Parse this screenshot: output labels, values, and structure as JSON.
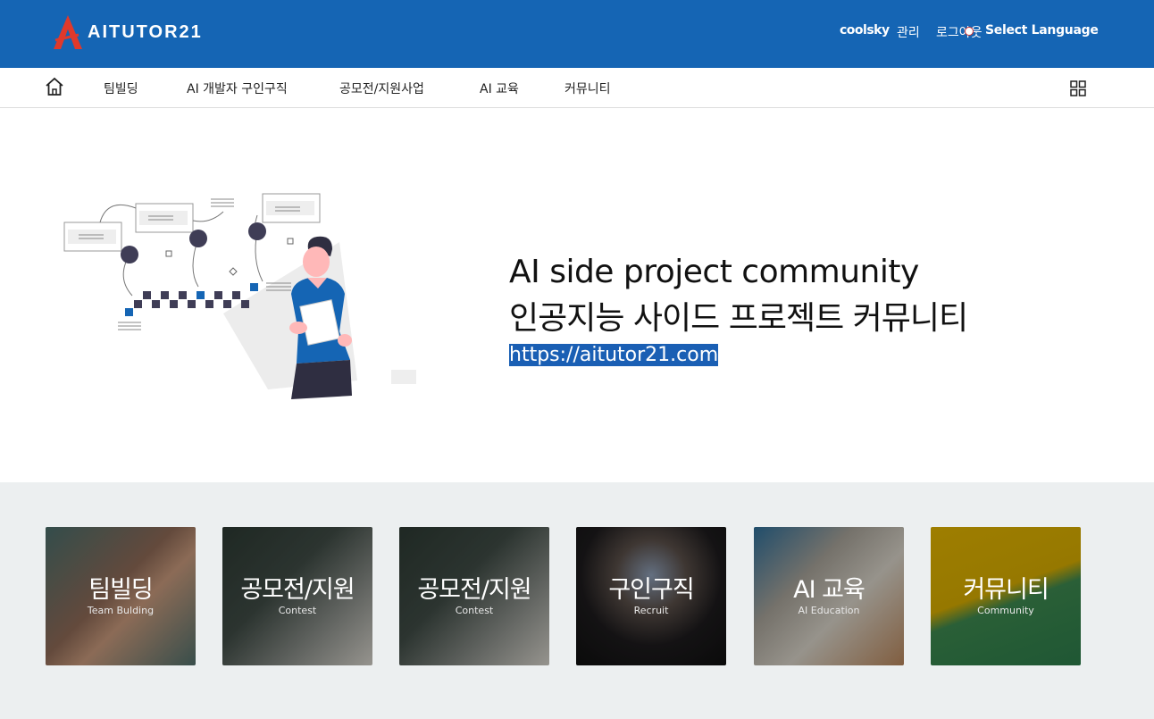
{
  "header": {
    "logo_text": "AITUTOR21",
    "user": "coolsky",
    "admin": "관리",
    "logout": "로그아웃",
    "language": "Select Language"
  },
  "nav": {
    "items": [
      {
        "label": "팀빌딩"
      },
      {
        "label": "AI 개발자 구인구직"
      },
      {
        "label": "공모전/지원사업"
      },
      {
        "label": "AI 교육"
      },
      {
        "label": "커뮤니티"
      }
    ]
  },
  "hero": {
    "title_en": "AI side project community",
    "title_ko": "인공지능 사이드 프로젝트 커뮤니티",
    "url": "https://aitutor21.com"
  },
  "cards": [
    {
      "title": "팀빌딩",
      "subtitle": "Team Bulding"
    },
    {
      "title": "공모전/지원",
      "subtitle": "Contest"
    },
    {
      "title": "공모전/지원",
      "subtitle": "Contest"
    },
    {
      "title": "구인구직",
      "subtitle": "Recruit"
    },
    {
      "title": "AI 교육",
      "subtitle": "AI Education"
    },
    {
      "title": "커뮤니티",
      "subtitle": "Community"
    }
  ],
  "colors": {
    "header_blue": "#1565b4",
    "url_highlight": "#1a5fb4",
    "section_gray": "#eceff0"
  }
}
